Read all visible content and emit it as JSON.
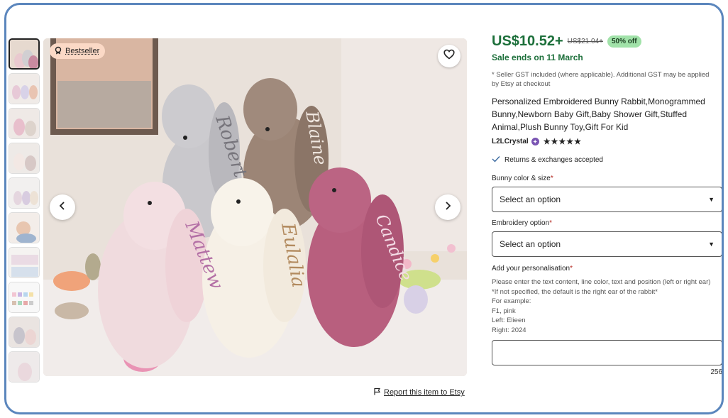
{
  "gallery": {
    "badge": "Bestseller",
    "thumb_count": 10,
    "names_on_bunnies": [
      "Robert",
      "Blaine",
      "Mattew",
      "Eulalia",
      "Candice"
    ]
  },
  "report_link": "Report this item to Etsy",
  "listing": {
    "price": "US$10.52+",
    "original_price": "US$21.04+",
    "discount": "50% off",
    "sale_ends": "Sale ends on 11 March",
    "gst_note": "* Seller GST included (where applicable). Additional GST may be applied by Etsy at checkout",
    "title": "Personalized Embroidered Bunny Rabbit,Monogrammed Bunny,Newborn Baby Gift,Baby Shower Gift,Stuffed Animal,Plush Bunny Toy,Gift For Kid",
    "shop_name": "L2LCrystal",
    "rating_stars": "★★★★★",
    "rating": 5,
    "returns": "Returns & exchanges accepted"
  },
  "options": {
    "color_label": "Bunny color & size",
    "color_value": "Select an option",
    "embroidery_label": "Embroidery option",
    "embroidery_value": "Select an option",
    "personalisation_label": "Add your personalisation",
    "instructions": [
      "Please enter the text content, line color, text and position (left or right ear)",
      "*If not specified, the default is the right ear of the rabbit*",
      "For example:",
      "F1, pink",
      "Left: Elieen",
      "Right: 2024"
    ],
    "char_count": "256"
  },
  "colors": {
    "price_green": "#1c6f3a",
    "discount_bg": "#a1e2a9",
    "badge_bg": "#fbd9c6",
    "frame": "#5b86bd"
  }
}
